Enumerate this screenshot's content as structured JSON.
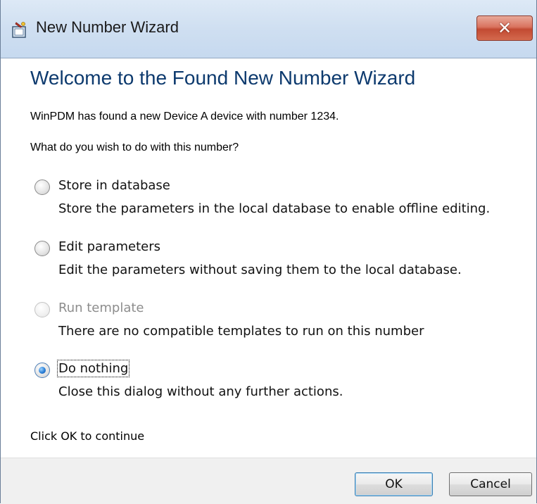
{
  "window": {
    "title": "New Number Wizard",
    "app_icon": "wizard-app-icon",
    "close_icon": "close-icon"
  },
  "heading": "Welcome to the Found New Number Wizard",
  "intro": "WinPDM has found a new Device A device with number 1234.",
  "question": "What do you wish to do with this number?",
  "options": [
    {
      "label": "Store in database",
      "description": "Store the parameters in the local database to enable offline editing.",
      "checked": false,
      "enabled": true
    },
    {
      "label": "Edit parameters",
      "description": "Edit the parameters without saving them to the local database.",
      "checked": false,
      "enabled": true
    },
    {
      "label": "Run template",
      "description": "There are no compatible templates to run on this number",
      "checked": false,
      "enabled": false
    },
    {
      "label": "Do nothing",
      "description": "Close this dialog without any further actions.",
      "checked": true,
      "enabled": true
    }
  ],
  "footer_note": "Click OK to continue",
  "buttons": {
    "ok": "OK",
    "cancel": "Cancel"
  },
  "colors": {
    "heading": "#0d3a6e",
    "titlebar": "#cfdff1",
    "close_button": "#c24a32",
    "disabled_text": "#8d8d8d",
    "button_bar": "#f0f0f0"
  }
}
